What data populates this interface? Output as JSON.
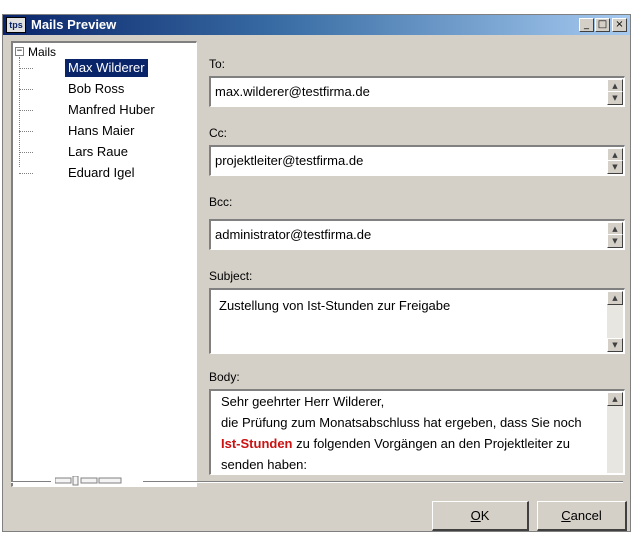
{
  "window": {
    "title": "Mails Preview",
    "icon_text": "tps",
    "controls": {
      "minimize": "_",
      "maximize": "□",
      "close": "×"
    }
  },
  "tree": {
    "root_label": "Mails",
    "expander": "−",
    "items": [
      {
        "label": "Max Wilderer",
        "selected": true
      },
      {
        "label": "Bob Ross"
      },
      {
        "label": "Manfred Huber"
      },
      {
        "label": "Hans Maier"
      },
      {
        "label": "Lars Raue"
      },
      {
        "label": "Eduard Igel"
      }
    ]
  },
  "fields": {
    "to": {
      "label": "To:",
      "value": "max.wilderer@testfirma.de"
    },
    "cc": {
      "label": "Cc:",
      "value": "projektleiter@testfirma.de"
    },
    "bcc": {
      "label": "Bcc:",
      "value": "administrator@testfirma.de"
    },
    "subject": {
      "label": "Subject:",
      "value": "Zustellung von Ist-Stunden zur Freigabe"
    },
    "body": {
      "label": "Body:",
      "line1": "Sehr geehrter Herr Wilderer,",
      "line2": "die Prüfung zum Monatsabschluss hat ergeben, dass Sie noch",
      "line3_highlight": "Ist-Stunden",
      "line3_rest": " zu folgenden Vorgängen an den Projektleiter zu",
      "line4": "senden haben:"
    }
  },
  "scroll": {
    "up": "▲",
    "down": "▼"
  },
  "buttons": {
    "ok_mnemonic": "O",
    "ok_rest": "K",
    "cancel_mnemonic": "C",
    "cancel_rest": "ancel"
  },
  "colors": {
    "titlebar": "#0a246a",
    "selection": "#0a246a",
    "highlight_text": "#cc1111",
    "face": "#d4d0c8"
  }
}
